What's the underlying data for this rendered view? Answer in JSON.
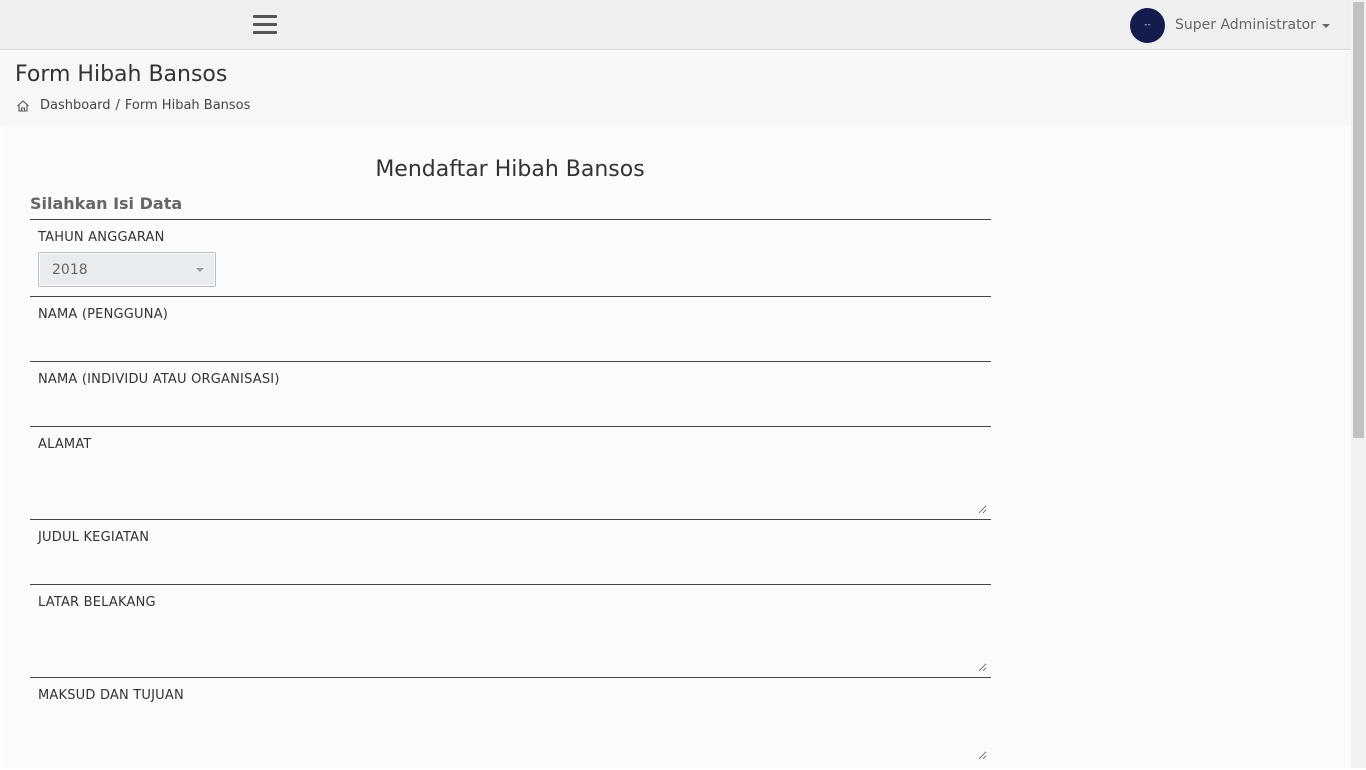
{
  "topbar": {
    "menu_icon": "hamburger-menu-icon",
    "avatar_text": "--",
    "user_name": "Super Administrator",
    "colors": {
      "avatar_bg": "#141b4d",
      "bar_bg": "#efefef"
    }
  },
  "page": {
    "title": "Form Hibah Bansos",
    "breadcrumb": {
      "home_icon": "home-icon",
      "dashboard": "Dashboard",
      "separator": "/",
      "current": "Form Hibah Bansos"
    }
  },
  "form": {
    "heading": "Mendaftar Hibah Bansos",
    "section_title": "Silahkan Isi Data",
    "fields": {
      "tahun_anggaran": {
        "label": "TAHUN ANGGARAN",
        "selected": "2018"
      },
      "nama_pengguna": {
        "label": "NAMA (PENGGUNA)",
        "value": ""
      },
      "nama_individu": {
        "label": "NAMA (INDIVIDU ATAU ORGANISASI)",
        "value": ""
      },
      "alamat": {
        "label": "ALAMAT",
        "value": ""
      },
      "judul_kegiatan": {
        "label": "JUDUL KEGIATAN",
        "value": ""
      },
      "latar_belakang": {
        "label": "LATAR BELAKANG",
        "value": ""
      },
      "maksud_tujuan": {
        "label": "MAKSUD DAN TUJUAN",
        "value": ""
      }
    }
  }
}
